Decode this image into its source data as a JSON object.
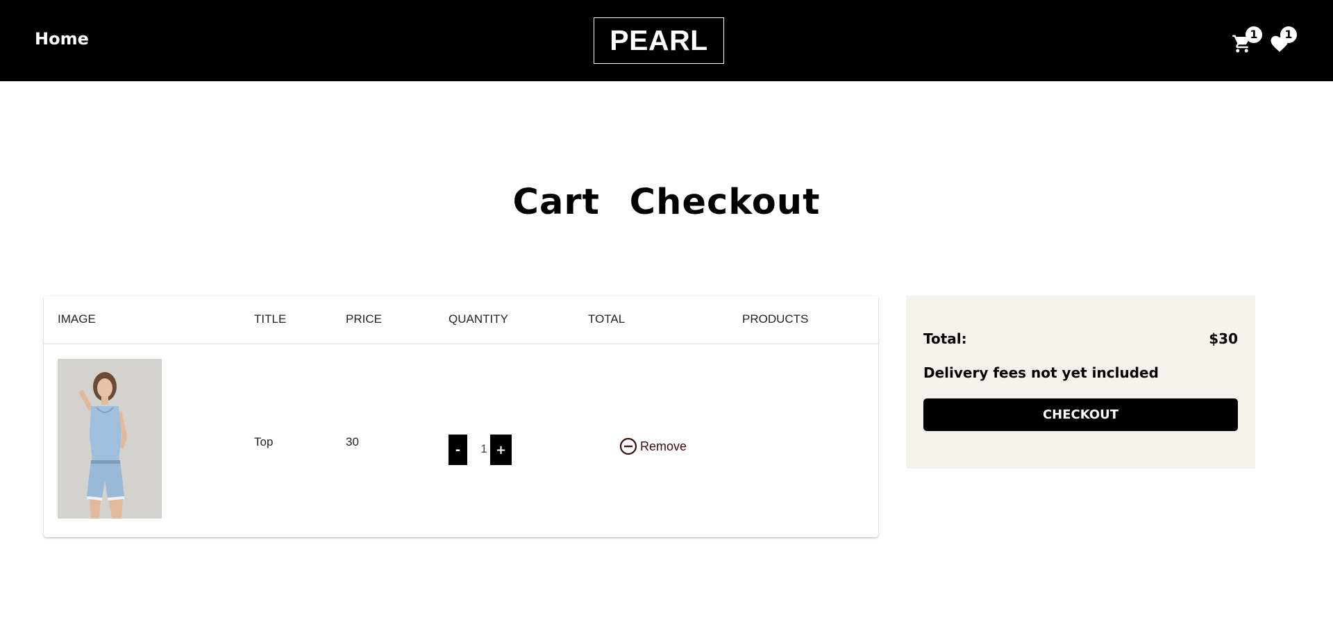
{
  "navbar": {
    "home_label": "Home",
    "brand": "PEARL",
    "cart_count": "1",
    "wishlist_count": "1",
    "cart_icon": "cart-icon",
    "wishlist_icon": "heart-icon"
  },
  "page": {
    "title": "Cart Checkout"
  },
  "cart_table": {
    "headers": [
      "IMAGE",
      "TITLE",
      "PRICE",
      "QUANTITY",
      "TOTAL",
      "PRODUCTS"
    ],
    "rows": [
      {
        "image": "product-photo-top",
        "title": "Top",
        "price": "30",
        "quantity": "1",
        "decrement_label": "-",
        "increment_label": "+",
        "total": "",
        "remove_label": "Remove",
        "remove_icon": "minus-circle-icon"
      }
    ]
  },
  "summary": {
    "total_label": "Total:",
    "total_value": "$30",
    "note": "Delivery fees not yet included",
    "checkout_label": "CHECKOUT"
  },
  "colors": {
    "navbar_bg": "#000000",
    "summary_bg": "#f5f2ee",
    "remove_color": "#3b0a0a",
    "button_bg": "#000000"
  }
}
